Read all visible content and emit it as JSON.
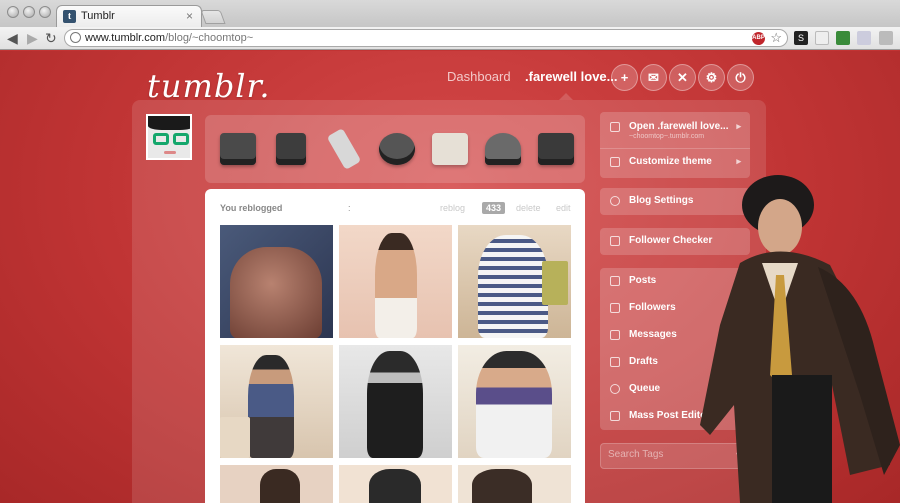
{
  "browser": {
    "tab_title": "Tumblr",
    "tab_close": "×",
    "url_host": "www.tumblr.com",
    "url_path": "/blog/~choomtop~",
    "back": "◀",
    "forward": "▶",
    "reload": "↻",
    "abp_label": "ABP",
    "star": "☆"
  },
  "header": {
    "logo": "tumblr.",
    "nav_dashboard": "Dashboard",
    "nav_blog": ".farewell love...",
    "action_new": "+",
    "action_inbox": "✉",
    "action_activity": "✕",
    "action_settings": "⚙",
    "action_logout": "⏻"
  },
  "post_types": [
    {
      "label": "Text",
      "color": "#4a4a4a"
    },
    {
      "label": "Photo",
      "color": "#3d3d3d"
    },
    {
      "label": "Quote",
      "color": "#d8d8d8"
    },
    {
      "label": "Link",
      "color": "#555555"
    },
    {
      "label": "Chat",
      "color": "#e6e0d6"
    },
    {
      "label": "Audio",
      "color": "#6a6a6a"
    },
    {
      "label": "Video",
      "color": "#3a3a3a"
    }
  ],
  "dashboard": {
    "reblogged_label": "You reblogged",
    "colon": ":",
    "reblog": "reblog",
    "count": "433",
    "delete": "delete",
    "edit": "edit"
  },
  "sidebar": {
    "blog_open": "Open .farewell love...",
    "blog_url": "~choomtop~.tumblr.com",
    "customize": "Customize theme",
    "blog_settings": "Blog Settings",
    "follower_checker": "Follower Checker",
    "posts": "Posts",
    "followers": "Followers",
    "messages": "Messages",
    "drafts": "Drafts",
    "queue": "Queue",
    "mass_post_editor": "Mass Post Editor",
    "chevron": "▸",
    "search_placeholder": "Search Tags",
    "search_arrow": "▾"
  }
}
